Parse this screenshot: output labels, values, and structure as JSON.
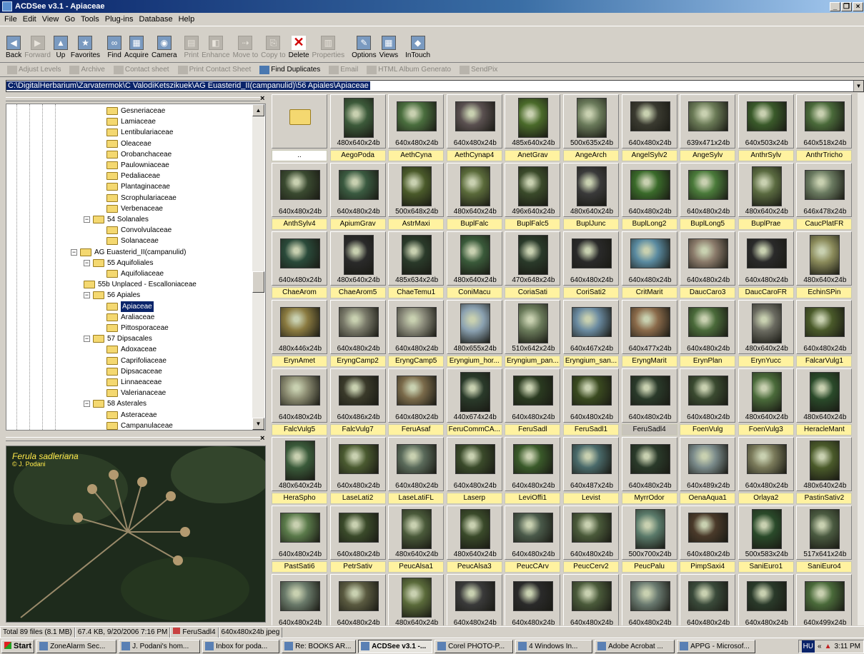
{
  "window": {
    "title": "ACDSee v3.1 - Apiaceae"
  },
  "menu": [
    "File",
    "Edit",
    "View",
    "Go",
    "Tools",
    "Plug-ins",
    "Database",
    "Help"
  ],
  "toolbar": [
    {
      "label": "Back",
      "icon": "back-icon",
      "enabled": true
    },
    {
      "label": "Forward",
      "icon": "forward-icon",
      "enabled": false
    },
    {
      "label": "Up",
      "icon": "up-icon",
      "enabled": true
    },
    {
      "label": "Favorites",
      "icon": "favorites-icon",
      "enabled": true
    },
    {
      "label": "Find",
      "icon": "binoculars-icon",
      "enabled": true
    },
    {
      "label": "Acquire",
      "icon": "acquire-icon",
      "enabled": true
    },
    {
      "label": "Camera",
      "icon": "camera-icon",
      "enabled": true
    },
    {
      "label": "Print",
      "icon": "printer-icon",
      "enabled": false
    },
    {
      "label": "Enhance",
      "icon": "enhance-icon",
      "enabled": false
    },
    {
      "label": "Move to",
      "icon": "move-icon",
      "enabled": false
    },
    {
      "label": "Copy to",
      "icon": "copy-icon",
      "enabled": false
    },
    {
      "label": "Delete",
      "icon": "delete-icon",
      "enabled": true
    },
    {
      "label": "Properties",
      "icon": "properties-icon",
      "enabled": false
    },
    {
      "label": "Options",
      "icon": "options-icon",
      "enabled": true
    },
    {
      "label": "Views",
      "icon": "views-icon",
      "enabled": true
    },
    {
      "label": "InTouch",
      "icon": "intouch-icon",
      "enabled": true
    }
  ],
  "toolbar2": [
    {
      "label": "Adjust Levels",
      "enabled": false
    },
    {
      "label": "Archive",
      "enabled": false
    },
    {
      "label": "Contact sheet",
      "enabled": false
    },
    {
      "label": "Print Contact Sheet",
      "enabled": false
    },
    {
      "label": "Find Duplicates",
      "enabled": true
    },
    {
      "label": "Email",
      "enabled": false
    },
    {
      "label": "HTML Album Generato",
      "enabled": false
    },
    {
      "label": "SendPix",
      "enabled": false
    }
  ],
  "address": "C:\\DigitalHerbarium\\Zarvatermok\\C ValodiKetszikuek\\AG Euasterid_II(campanulid)\\56 Apiales\\Apiaceae",
  "tree": [
    {
      "label": "Gesneriaceae",
      "indent": 5,
      "pm": ""
    },
    {
      "label": "Lamiaceae",
      "indent": 5,
      "pm": ""
    },
    {
      "label": "Lentibulariaceae",
      "indent": 5,
      "pm": ""
    },
    {
      "label": "Oleaceae",
      "indent": 5,
      "pm": ""
    },
    {
      "label": "Orobanchaceae",
      "indent": 5,
      "pm": ""
    },
    {
      "label": "Paulowniaceae",
      "indent": 5,
      "pm": ""
    },
    {
      "label": "Pedaliaceae",
      "indent": 5,
      "pm": ""
    },
    {
      "label": "Plantaginaceae",
      "indent": 5,
      "pm": ""
    },
    {
      "label": "Scrophulariaceae",
      "indent": 5,
      "pm": ""
    },
    {
      "label": "Verbenaceae",
      "indent": 5,
      "pm": ""
    },
    {
      "label": "54 Solanales",
      "indent": 4,
      "pm": "−"
    },
    {
      "label": "Convolvulaceae",
      "indent": 5,
      "pm": ""
    },
    {
      "label": "Solanaceae",
      "indent": 5,
      "pm": ""
    },
    {
      "label": "AG Euasterid_II(campanulid)",
      "indent": 3,
      "pm": "−"
    },
    {
      "label": "55 Aquifoliales",
      "indent": 4,
      "pm": "−"
    },
    {
      "label": "Aquifoliaceae",
      "indent": 5,
      "pm": ""
    },
    {
      "label": "55b Unplaced - Escalloniaceae",
      "indent": 4,
      "pm": ""
    },
    {
      "label": "56 Apiales",
      "indent": 4,
      "pm": "−"
    },
    {
      "label": "Apiaceae",
      "indent": 5,
      "pm": "",
      "selected": true
    },
    {
      "label": "Araliaceae",
      "indent": 5,
      "pm": ""
    },
    {
      "label": "Pittosporaceae",
      "indent": 5,
      "pm": ""
    },
    {
      "label": "57 Dipsacales",
      "indent": 4,
      "pm": "−"
    },
    {
      "label": "Adoxaceae",
      "indent": 5,
      "pm": ""
    },
    {
      "label": "Caprifoliaceae",
      "indent": 5,
      "pm": ""
    },
    {
      "label": "Dipsacaceae",
      "indent": 5,
      "pm": ""
    },
    {
      "label": "Linnaeaceae",
      "indent": 5,
      "pm": ""
    },
    {
      "label": "Valerianaceae",
      "indent": 5,
      "pm": ""
    },
    {
      "label": "58 Asterales",
      "indent": 4,
      "pm": "−"
    },
    {
      "label": "Asteraceae",
      "indent": 5,
      "pm": ""
    },
    {
      "label": "Campanulaceae",
      "indent": 5,
      "pm": ""
    }
  ],
  "preview": {
    "caption": "Ferula sadleriana",
    "credit": "© J. Podani"
  },
  "thumbs": [
    {
      "name": "..",
      "dims": "",
      "folder": true
    },
    {
      "name": "AegoPoda",
      "dims": "480x640x24b",
      "color": "#3c5a3a"
    },
    {
      "name": "AethCyna",
      "dims": "640x480x24b",
      "color": "#4a6e3e"
    },
    {
      "name": "AethCynap4",
      "dims": "640x480x24b",
      "color": "#5a5050"
    },
    {
      "name": "AnetGrav",
      "dims": "485x640x24b",
      "color": "#4a6a2a"
    },
    {
      "name": "AngeArch",
      "dims": "500x635x24b",
      "color": "#6a7a5a"
    },
    {
      "name": "AngelSylv2",
      "dims": "640x480x24b",
      "color": "#3a3a30"
    },
    {
      "name": "AngeSylv",
      "dims": "639x471x24b",
      "color": "#6a7a56"
    },
    {
      "name": "AnthrSylv",
      "dims": "640x503x24b",
      "color": "#3a5a2a"
    },
    {
      "name": "AnthrTricho",
      "dims": "640x518x24b",
      "color": "#4a6a3a"
    },
    {
      "name": "AnthSylv4",
      "dims": "640x480x24b",
      "color": "#3a4a30"
    },
    {
      "name": "ApiumGrav",
      "dims": "640x480x24b",
      "color": "#3a5a40"
    },
    {
      "name": "AstrMaxi",
      "dims": "500x648x24b",
      "color": "#4a5a2a"
    },
    {
      "name": "BuplFalc",
      "dims": "480x640x24b",
      "color": "#5a6a3a"
    },
    {
      "name": "BuplFalc5",
      "dims": "496x640x24b",
      "color": "#3a4a2a"
    },
    {
      "name": "BuplJunc",
      "dims": "480x640x24b",
      "color": "#3a3a3a"
    },
    {
      "name": "BuplLong2",
      "dims": "640x480x24b",
      "color": "#3a6a2a"
    },
    {
      "name": "BuplLong5",
      "dims": "640x480x24b",
      "color": "#4a7a3a"
    },
    {
      "name": "BuplPrae",
      "dims": "480x640x24b",
      "color": "#5a6a40"
    },
    {
      "name": "CaucPlatFR",
      "dims": "646x478x24b",
      "color": "#6a7a60"
    },
    {
      "name": "ChaeArom",
      "dims": "640x480x24b",
      "color": "#2a4a3a"
    },
    {
      "name": "ChaeArom5",
      "dims": "480x640x24b",
      "color": "#2a2a2a"
    },
    {
      "name": "ChaeTemu1",
      "dims": "485x634x24b",
      "color": "#2a3a2a"
    },
    {
      "name": "ConiMacu",
      "dims": "480x640x24b",
      "color": "#3a5a3a"
    },
    {
      "name": "CoriaSati",
      "dims": "470x648x24b",
      "color": "#2a3a2a"
    },
    {
      "name": "CoriSati2",
      "dims": "640x480x24b",
      "color": "#2a2a2a"
    },
    {
      "name": "CritMarit",
      "dims": "640x480x24b",
      "color": "#5a8aa0"
    },
    {
      "name": "DaucCaro3",
      "dims": "640x480x24b",
      "color": "#8a7a6a"
    },
    {
      "name": "DaucCaroFR",
      "dims": "640x480x24b",
      "color": "#2a2a2a"
    },
    {
      "name": "EchinSPin",
      "dims": "480x640x24b",
      "color": "#8a8a5a"
    },
    {
      "name": "ErynAmet",
      "dims": "480x446x24b",
      "color": "#8a7a40"
    },
    {
      "name": "EryngCamp2",
      "dims": "640x480x24b",
      "color": "#7a7a6a"
    },
    {
      "name": "EryngCamp5",
      "dims": "640x480x24b",
      "color": "#8a8a7a"
    },
    {
      "name": "Eryngium_hor...",
      "dims": "480x655x24b",
      "color": "#8aa0b0"
    },
    {
      "name": "Eryngium_pan...",
      "dims": "510x642x24b",
      "color": "#6a7a5a"
    },
    {
      "name": "Eryngium_san...",
      "dims": "640x467x24b",
      "color": "#6a8aa0"
    },
    {
      "name": "EryngMarit",
      "dims": "640x477x24b",
      "color": "#8a6a4a"
    },
    {
      "name": "ErynPlan",
      "dims": "640x480x24b",
      "color": "#4a6a3a"
    },
    {
      "name": "ErynYucc",
      "dims": "480x640x24b",
      "color": "#6a6a60"
    },
    {
      "name": "FalcarVulg1",
      "dims": "640x480x24b",
      "color": "#4a5a2a"
    },
    {
      "name": "FalcVulg5",
      "dims": "640x480x24b",
      "color": "#8a8a70"
    },
    {
      "name": "FalcVulg7",
      "dims": "640x486x24b",
      "color": "#3a3a2a"
    },
    {
      "name": "FeruAsaf",
      "dims": "640x480x24b",
      "color": "#7a6a4a"
    },
    {
      "name": "FeruCommCA...",
      "dims": "440x674x24b",
      "color": "#2a3a2a"
    },
    {
      "name": "FeruSadl",
      "dims": "640x480x24b",
      "color": "#2a3a20"
    },
    {
      "name": "FeruSadl1",
      "dims": "640x480x24b",
      "color": "#3a4a20"
    },
    {
      "name": "FeruSadl4",
      "dims": "640x480x24b",
      "color": "#2a3a2a",
      "selected": true
    },
    {
      "name": "FoenVulg",
      "dims": "640x480x24b",
      "color": "#3a4a30"
    },
    {
      "name": "FoenVulg3",
      "dims": "480x640x24b",
      "color": "#4a6a3a"
    },
    {
      "name": "HeracleMant",
      "dims": "480x640x24b",
      "color": "#2a4a2a"
    },
    {
      "name": "HeraSpho",
      "dims": "480x640x24b",
      "color": "#3a5a3a"
    },
    {
      "name": "LaseLati2",
      "dims": "640x480x24b",
      "color": "#4a5a30"
    },
    {
      "name": "LaseLatiFL",
      "dims": "640x480x24b",
      "color": "#5a6a5a"
    },
    {
      "name": "Laserp",
      "dims": "640x480x24b",
      "color": "#3a4a2a"
    },
    {
      "name": "LeviOffi1",
      "dims": "640x480x24b",
      "color": "#3a5a2a"
    },
    {
      "name": "Levist",
      "dims": "640x487x24b",
      "color": "#4a6a6a"
    },
    {
      "name": "MyrrOdor",
      "dims": "640x480x24b",
      "color": "#2a3a2a"
    },
    {
      "name": "OenaAqua1",
      "dims": "640x489x24b",
      "color": "#7a8a8a"
    },
    {
      "name": "Orlaya2",
      "dims": "640x480x24b",
      "color": "#7a7a5a"
    },
    {
      "name": "PastinSativ2",
      "dims": "480x640x24b",
      "color": "#4a5a2a"
    },
    {
      "name": "PastSati6",
      "dims": "640x480x24b",
      "color": "#5a7a4a"
    },
    {
      "name": "PetrSativ",
      "dims": "640x480x24b",
      "color": "#3a4a2a"
    },
    {
      "name": "PeucAlsa1",
      "dims": "480x640x24b",
      "color": "#4a5a3a"
    },
    {
      "name": "PeucAlsa3",
      "dims": "480x640x24b",
      "color": "#3a4a2a"
    },
    {
      "name": "PeucCArv",
      "dims": "640x480x24b",
      "color": "#4a5a4a"
    },
    {
      "name": "PeucCerv2",
      "dims": "640x480x24b",
      "color": "#4a5a3a"
    },
    {
      "name": "PeucPalu",
      "dims": "500x700x24b",
      "color": "#5a7a6a"
    },
    {
      "name": "PimpSaxi4",
      "dims": "640x480x24b",
      "color": "#4a3a2a"
    },
    {
      "name": "SaniEuro1",
      "dims": "500x583x24b",
      "color": "#2a4a2a"
    },
    {
      "name": "SaniEuro4",
      "dims": "517x641x24b",
      "color": "#4a5a40"
    },
    {
      "name": "",
      "dims": "640x480x24b",
      "color": "#6a7a6a"
    },
    {
      "name": "",
      "dims": "640x480x24b",
      "color": "#5a5a40"
    },
    {
      "name": "",
      "dims": "480x640x24b",
      "color": "#5a6a3a"
    },
    {
      "name": "",
      "dims": "640x480x24b",
      "color": "#3a3a3a"
    },
    {
      "name": "",
      "dims": "640x480x24b",
      "color": "#2a2a2a"
    },
    {
      "name": "",
      "dims": "640x480x24b",
      "color": "#4a5a3a"
    },
    {
      "name": "",
      "dims": "640x480x24b",
      "color": "#6a7a70"
    },
    {
      "name": "",
      "dims": "640x480x24b",
      "color": "#3a4a3a"
    },
    {
      "name": "",
      "dims": "640x480x24b",
      "color": "#2a3a2a"
    },
    {
      "name": "",
      "dims": "640x499x24b",
      "color": "#4a6a3a"
    }
  ],
  "status": {
    "total": "Total 89 files (8.1 MB)",
    "info": "67.4 KB, 9/20/2006 7:16 PM",
    "file": "FeruSadl4",
    "fmt": "640x480x24b jpeg"
  },
  "taskbar": {
    "start": "Start",
    "tasks": [
      {
        "label": "ZoneAlarm Sec...",
        "active": false
      },
      {
        "label": "J. Podani's hom...",
        "active": false
      },
      {
        "label": "Inbox for poda...",
        "active": false
      },
      {
        "label": "Re: BOOKS AR...",
        "active": false
      },
      {
        "label": "ACDSee v3.1 -...",
        "active": true
      },
      {
        "label": "Corel PHOTO-P...",
        "active": false
      },
      {
        "label": "4 Windows In...",
        "active": false
      },
      {
        "label": "Adobe Acrobat ...",
        "active": false
      },
      {
        "label": "APPG - Microsof...",
        "active": false
      }
    ],
    "lang": "HU",
    "clock": "3:11 PM"
  }
}
